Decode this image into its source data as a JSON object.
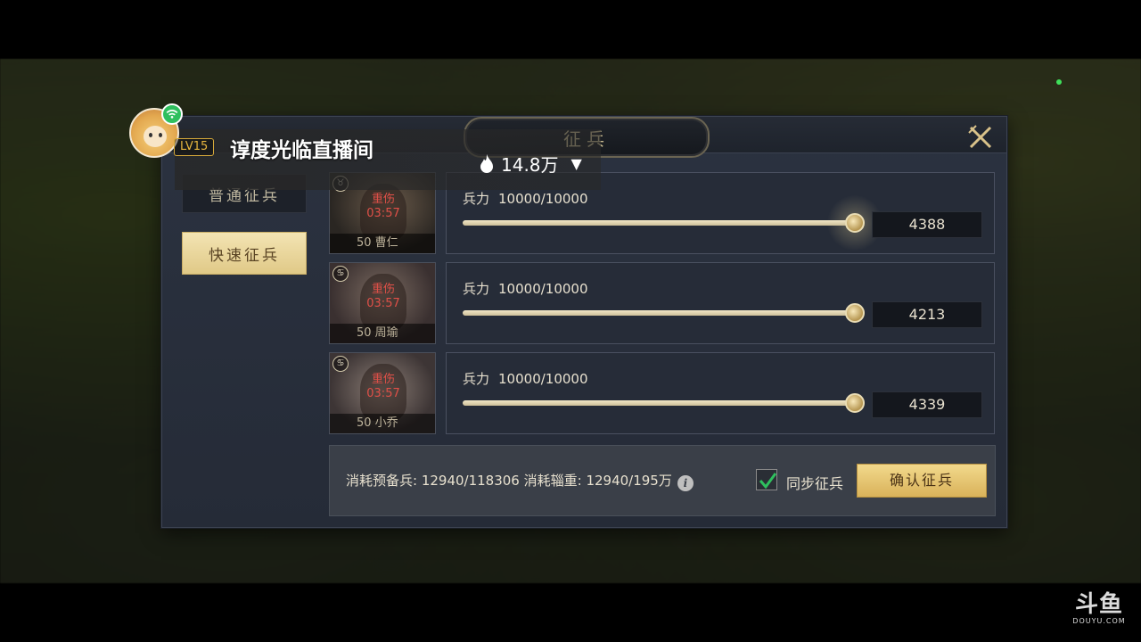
{
  "stream": {
    "level": "LV15",
    "room_title": "谆度光临直播间",
    "heat": "14.8万",
    "dropdown_glyph": "▼"
  },
  "dialog": {
    "title": "征兵",
    "tabs": [
      {
        "label": "普通征兵",
        "active": false
      },
      {
        "label": "快速征兵",
        "active": true
      }
    ],
    "troop_label": "兵力",
    "heroes": [
      {
        "injury": "重伤",
        "timer": "03:57",
        "name": "50 曹仁",
        "troops": "10000/10000",
        "amount": "4388"
      },
      {
        "injury": "重伤",
        "timer": "03:57",
        "name": "50 周瑜",
        "troops": "10000/10000",
        "amount": "4213"
      },
      {
        "injury": "重伤",
        "timer": "03:57",
        "name": "50 小乔",
        "troops": "10000/10000",
        "amount": "4339"
      }
    ],
    "footer": {
      "cost_text": "消耗预备兵: 12940/118306 消耗辎重: 12940/195万",
      "sync_label": "同步征兵",
      "sync_checked": true,
      "confirm_label": "确认征兵"
    }
  },
  "watermark": {
    "brand": "斗鱼",
    "domain": "DOUYU.COM"
  },
  "colors": {
    "accent_gold": "#e0c987",
    "injury_red": "#e05048",
    "check_green": "#2fbf5e"
  }
}
